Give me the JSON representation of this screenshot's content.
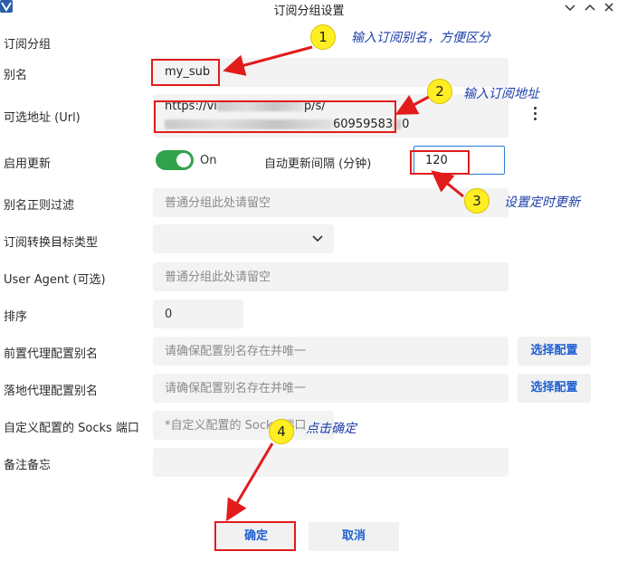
{
  "window": {
    "title": "订阅分组设置"
  },
  "form": {
    "group_label": "订阅分组",
    "alias": {
      "label": "别名",
      "value": "my_sub"
    },
    "url": {
      "label": "可选地址 (Url)",
      "line1": "https://vi",
      "line1_tail": "p/s/",
      "line2_tail": "60959583",
      "line2_end": "0"
    },
    "auto_update": {
      "label": "启用更新",
      "toggle_text": "On",
      "interval_label": "自动更新间隔 (分钟)",
      "interval_value": "120"
    },
    "alias_filter": {
      "label": "别名正则过滤",
      "placeholder": "普通分组此处请留空"
    },
    "target_type": {
      "label": "订阅转换目标类型",
      "value": ""
    },
    "user_agent": {
      "label": "User Agent (可选)",
      "placeholder": "普通分组此处请留空"
    },
    "sort": {
      "label": "排序",
      "value": "0"
    },
    "front_proxy": {
      "label": "前置代理配置别名",
      "placeholder": "请确保配置别名存在并唯一",
      "button": "选择配置"
    },
    "landing_proxy": {
      "label": "落地代理配置别名",
      "placeholder": "请确保配置别名存在并唯一",
      "button": "选择配置"
    },
    "socks_port": {
      "label": "自定义配置的 Socks 端口",
      "placeholder": "*自定义配置的 Socks 端口"
    },
    "remarks": {
      "label": "备注备忘",
      "value": ""
    }
  },
  "buttons": {
    "ok": "确定",
    "cancel": "取消"
  },
  "annotations": {
    "step1": {
      "number": "1",
      "text": "输入订阅别名，方便区分"
    },
    "step2": {
      "number": "2",
      "text": "输入订阅地址"
    },
    "step3": {
      "number": "3",
      "text": "设置定时更新"
    },
    "step4": {
      "number": "4",
      "text": "点击确定"
    }
  },
  "colors": {
    "accent": "#1f5fd1",
    "toggle_on": "#31a24c",
    "highlight": "#e21b1b",
    "badge": "#ffee22",
    "note": "#1f3fa8"
  },
  "icons": {
    "app": "app-logo-icon",
    "minimize": "chevron-down-icon",
    "maximize": "chevron-up-icon",
    "close": "close-icon",
    "more": "kebab-menu-icon",
    "dropdown": "chevron-down-icon"
  }
}
